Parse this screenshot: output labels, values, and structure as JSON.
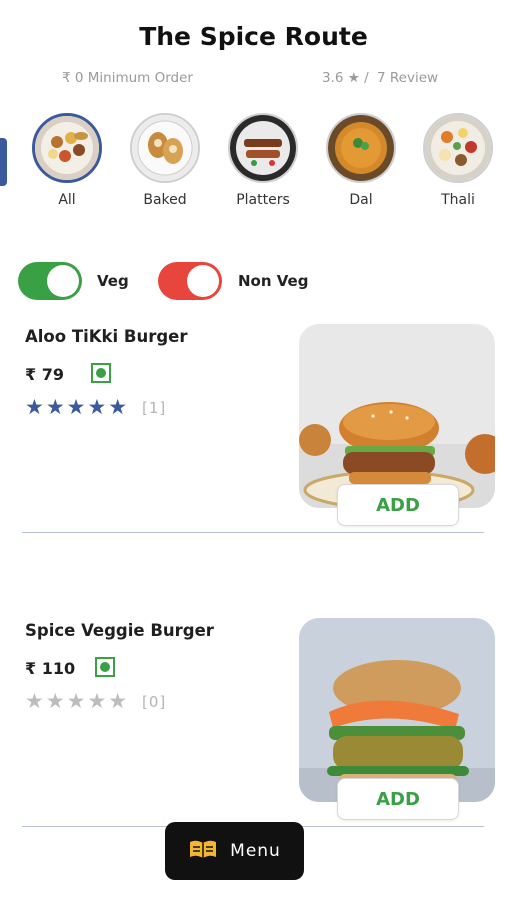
{
  "header": {
    "restaurant_name": "The Spice Route",
    "min_order": "₹ 0 Minimum Order",
    "rating": "3.6 ★ /",
    "reviews": "7 Review"
  },
  "categories": [
    {
      "label": "All",
      "selected": true
    },
    {
      "label": "Baked"
    },
    {
      "label": "Platters"
    },
    {
      "label": "Dal"
    },
    {
      "label": "Thali"
    }
  ],
  "filters": {
    "veg": {
      "label": "Veg",
      "on": true,
      "color": "#3aa046"
    },
    "non_veg": {
      "label": "Non Veg",
      "on": true,
      "color": "#e8453c"
    }
  },
  "items": [
    {
      "name": "Aloo TiKki Burger",
      "price": "₹ 79",
      "stars": "★★★★★",
      "rating_count": "[1]",
      "star_color": "#3a5a9c",
      "add_label": "ADD"
    },
    {
      "name": "Spice Veggie Burger",
      "price": "₹ 110",
      "stars": "★★★★★",
      "rating_count": "[0]",
      "star_color": "#bdbdbd",
      "add_label": "ADD"
    }
  ],
  "menu_button": {
    "label": "Menu",
    "icon": "menu-book-icon"
  }
}
